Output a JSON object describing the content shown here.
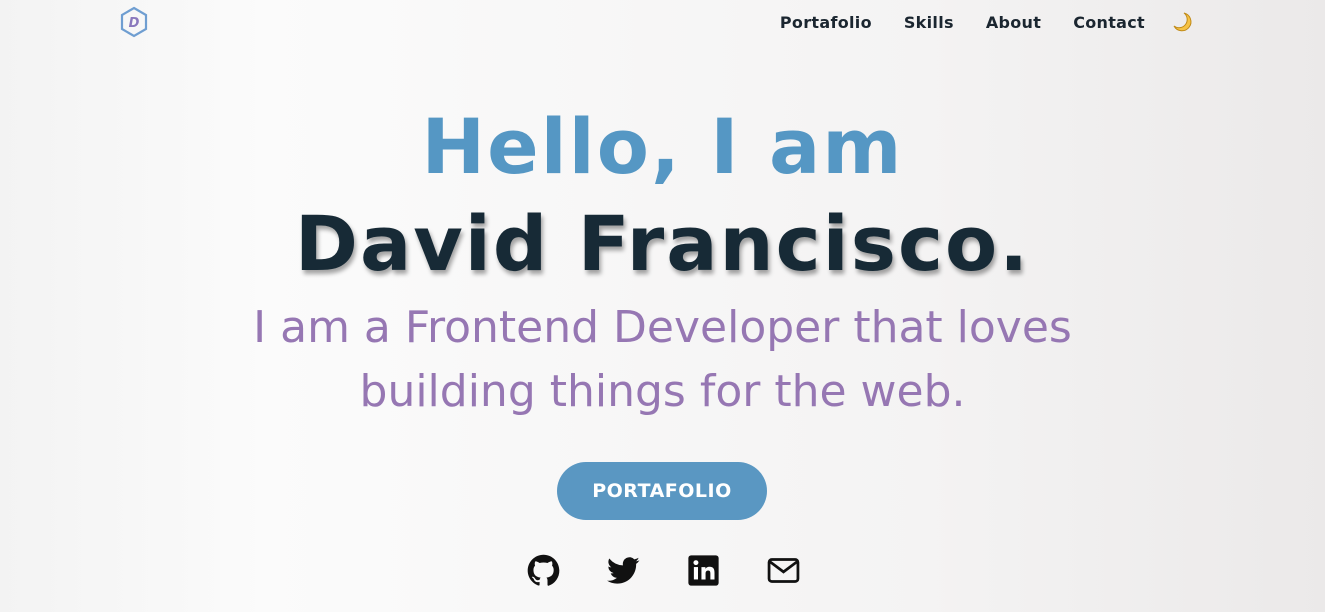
{
  "nav": {
    "logo_letter": "D",
    "links": [
      "Portafolio",
      "Skills",
      "About",
      "Contact"
    ],
    "theme_icon": "moon-icon"
  },
  "hero": {
    "greeting": "Hello, I am",
    "name": "David Francisco.",
    "tagline": "I am a Frontend Developer that loves building things for the web.",
    "cta_label": "PORTAFOLIO"
  },
  "socials": [
    "github-icon",
    "twitter-icon",
    "linkedin-icon",
    "mail-icon"
  ],
  "colors": {
    "accent_blue": "#5597c4",
    "name_dark": "#172a36",
    "tagline_purple": "#9677b3",
    "button_bg": "#5a97c2",
    "moon_yellow": "#f6c244"
  }
}
